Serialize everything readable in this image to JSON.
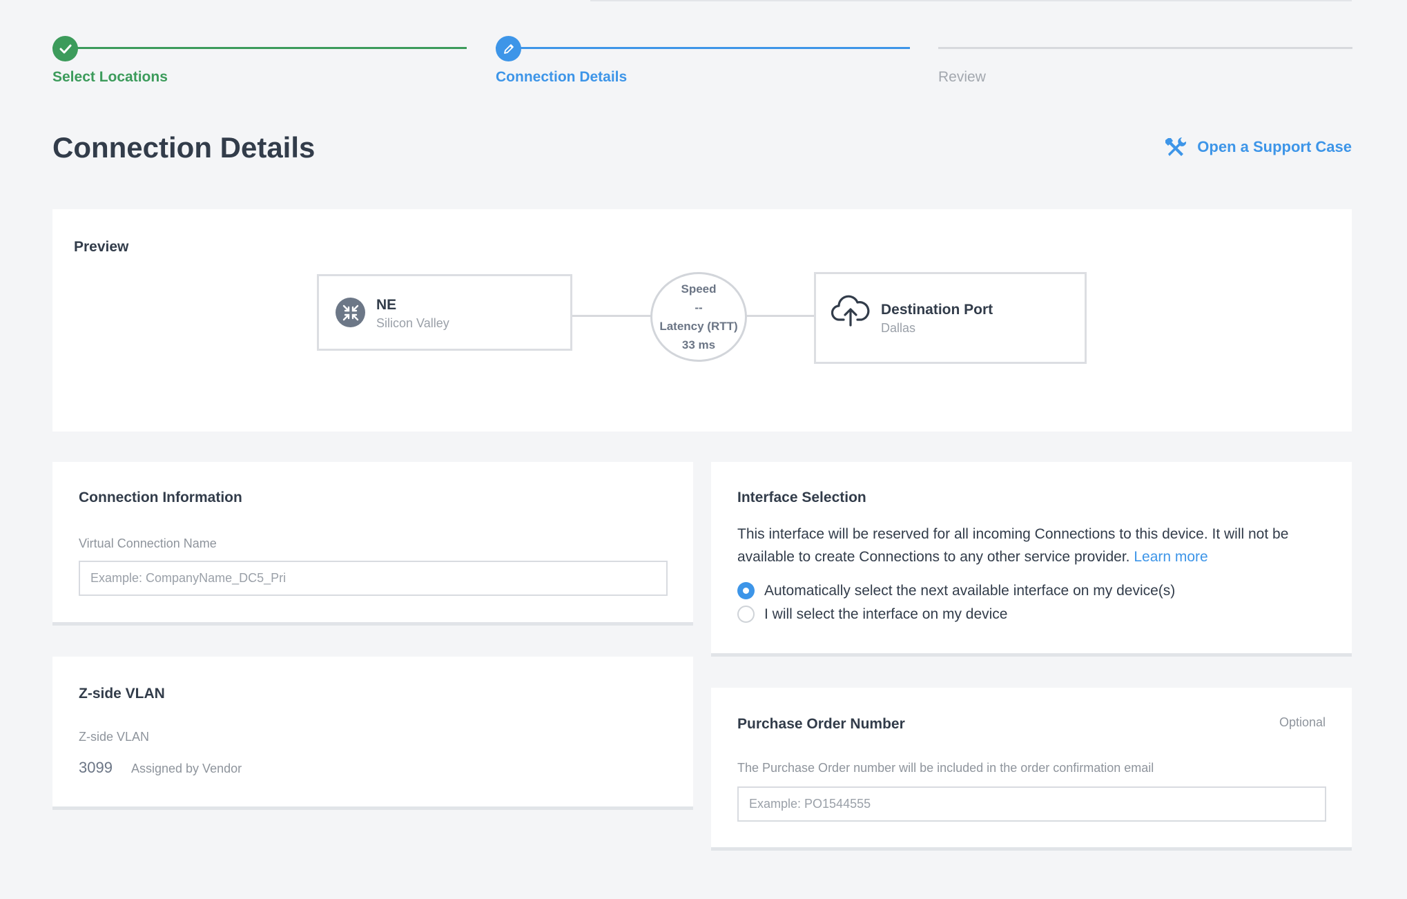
{
  "stepper": {
    "steps": [
      {
        "label": "Select Locations",
        "state": "complete"
      },
      {
        "label": "Connection Details",
        "state": "active"
      },
      {
        "label": "Review",
        "state": "pending"
      }
    ]
  },
  "header": {
    "title": "Connection Details",
    "support_link": "Open a Support Case",
    "support_icon": "tools-icon"
  },
  "preview": {
    "title": "Preview",
    "source": {
      "name": "NE",
      "location": "Silicon Valley",
      "icon": "router-icon"
    },
    "metrics": {
      "speed_label": "Speed",
      "speed_value": "--",
      "latency_label": "Latency (RTT)",
      "latency_value": "33 ms"
    },
    "destination": {
      "name": "Destination Port",
      "location": "Dallas",
      "icon": "cloud-upload-icon"
    }
  },
  "connection_info": {
    "title": "Connection Information",
    "name_label": "Virtual Connection Name",
    "name_placeholder": "Example: CompanyName_DC5_Pri",
    "name_value": ""
  },
  "zside_vlan": {
    "title": "Z-side VLAN",
    "label": "Z-side VLAN",
    "value": "3099",
    "note": "Assigned by Vendor"
  },
  "interface_selection": {
    "title": "Interface Selection",
    "description": "This interface will be reserved for all incoming Connections to this device. It will not be available to create Connections to any other service provider.",
    "learn_more": "Learn more",
    "options": [
      {
        "label": "Automatically select the next available interface on my device(s)",
        "selected": true
      },
      {
        "label": "I will select the interface on my device",
        "selected": false
      }
    ]
  },
  "purchase_order": {
    "title": "Purchase Order Number",
    "optional": "Optional",
    "help": "The Purchase Order number will be included in the order confirmation email",
    "placeholder": "Example: PO1544555",
    "value": ""
  },
  "colors": {
    "complete": "#3c9b5b",
    "active": "#3d95e8",
    "pending": "#d7d9dd",
    "background": "#f4f5f7"
  }
}
